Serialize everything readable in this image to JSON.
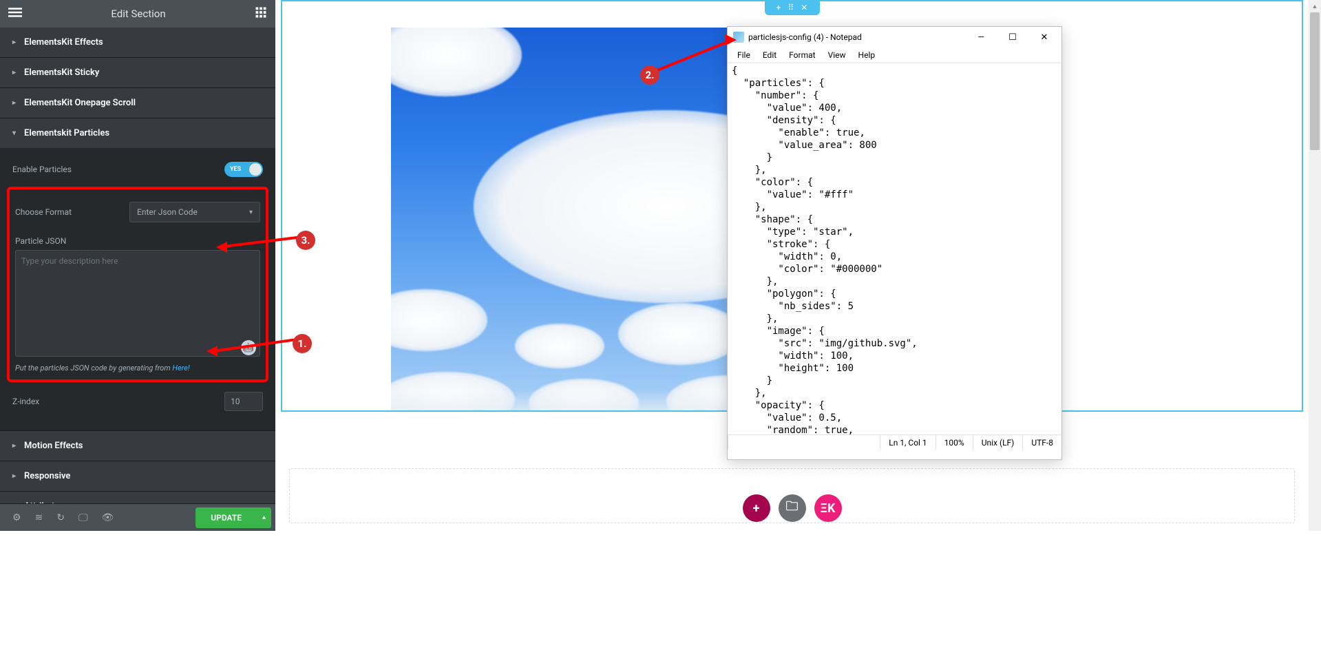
{
  "sidebar": {
    "title": "Edit Section",
    "accordion": {
      "effects": "ElementsKit Effects",
      "sticky": "ElementsKit Sticky",
      "onepage": "ElementsKit Onepage Scroll",
      "particles": "Elementskit Particles",
      "motion": "Motion Effects",
      "responsive": "Responsive",
      "attributes": "Attributes"
    },
    "enable_particles_label": "Enable Particles",
    "toggle_yes": "YES",
    "choose_format_label": "Choose Format",
    "choose_format_value": "Enter Json Code",
    "particle_json_label": "Particle JSON",
    "textarea_placeholder": "Type your description here",
    "helper_text_prefix": "Put the particles JSON code by generating from ",
    "helper_text_link": "Here!",
    "zindex_label": "Z-index",
    "zindex_value": "10",
    "update_btn": "UPDATE"
  },
  "callouts": {
    "c1": "1.",
    "c2": "2.",
    "c3": "3."
  },
  "notepad": {
    "title": "particlesjs-config (4) - Notepad",
    "menu": {
      "file": "File",
      "edit": "Edit",
      "format": "Format",
      "view": "View",
      "help": "Help"
    },
    "content": "{\n  \"particles\": {\n    \"number\": {\n      \"value\": 400,\n      \"density\": {\n        \"enable\": true,\n        \"value_area\": 800\n      }\n    },\n    \"color\": {\n      \"value\": \"#fff\"\n    },\n    \"shape\": {\n      \"type\": \"star\",\n      \"stroke\": {\n        \"width\": 0,\n        \"color\": \"#000000\"\n      },\n      \"polygon\": {\n        \"nb_sides\": 5\n      },\n      \"image\": {\n        \"src\": \"img/github.svg\",\n        \"width\": 100,\n        \"height\": 100\n      }\n    },\n    \"opacity\": {\n      \"value\": 0.5,\n      \"random\": true,",
    "status": {
      "ln_col": "Ln 1, Col 1",
      "zoom": "100%",
      "eol": "Unix (LF)",
      "encoding": "UTF-8"
    }
  }
}
